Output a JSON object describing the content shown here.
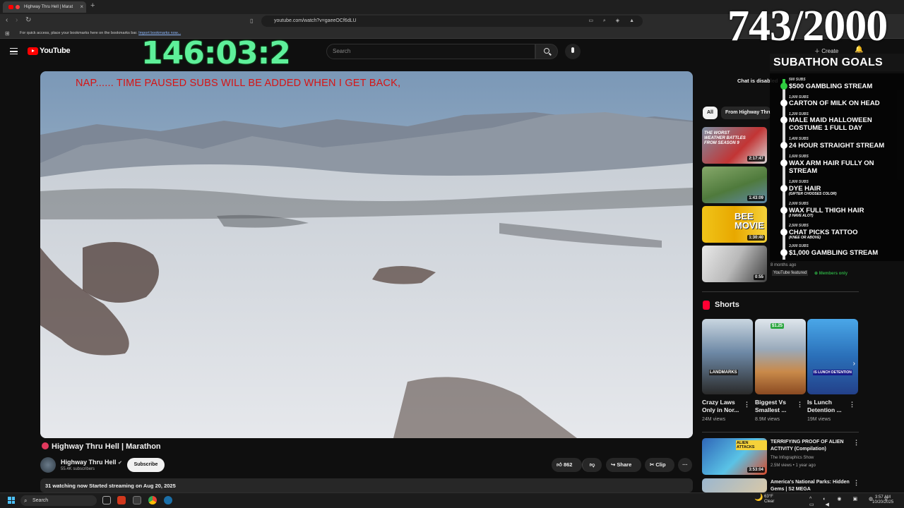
{
  "browser": {
    "tab_title": "Highway Thru Hell | Marat",
    "tab_close": "×",
    "new_tab": "+",
    "url": "youtube.com/watch?v=gaeeOCf6dLU",
    "bookmarks_hint": "For quick access, place your bookmarks here on the bookmarks bar.",
    "bookmarks_link": "Import bookmarks now..."
  },
  "header": {
    "logo_text": "YouTube",
    "search_placeholder": "Search",
    "create_label": "Create"
  },
  "stream_overlay": {
    "timer": "146:03:2",
    "sub_count": "743/2000",
    "video_banner": "NAP......  TIME PAUSED SUBS WILL BE ADDED WHEN I GET BACK,",
    "goals_title": "SUBATHON GOALS",
    "goals": [
      {
        "subs": "500 SUBS",
        "title": "$500 GAMBLING STREAM",
        "note": ""
      },
      {
        "subs": "1,000 SUBS",
        "title": "CARTON OF MILK ON HEAD",
        "note": ""
      },
      {
        "subs": "1,200 SUBS",
        "title": "MALE MAID HALLOWEEN COSTUME 1 FULL DAY",
        "note": ""
      },
      {
        "subs": "1,400 SUBS",
        "title": "24 HOUR STRAIGHT STREAM",
        "note": ""
      },
      {
        "subs": "1,600 SUBS",
        "title": "WAX ARM HAIR FULLY ON STREAM",
        "note": ""
      },
      {
        "subs": "1,800 SUBS",
        "title": "DYE HAIR",
        "note": "(GIFTER CHOOSES COLOR)"
      },
      {
        "subs": "2,000 SUBS",
        "title": "WAX FULL THIGH HAIR",
        "note": "(I HAVE ALOT)"
      },
      {
        "subs": "2,500 SUBS",
        "title": "CHAT PICKS TATTOO",
        "note": "(KNEE OR ABOVE)"
      },
      {
        "subs": "3,000 SUBS",
        "title": "$1,000 GAMBLING STREAM",
        "note": ""
      }
    ]
  },
  "video": {
    "title": "Highway Thru Hell | Marathon",
    "channel": "Highway Thru Hell",
    "subscribers": "55.4K subscribers",
    "subscribe_label": "Subscribe",
    "likes": "862",
    "share_label": "Share",
    "clip_label": "Clip",
    "more": "···",
    "description_line": "31 watching now  Started streaming on Aug 20, 2025"
  },
  "sidebar": {
    "chat_disabled": "Chat is disabled",
    "chips": [
      "All",
      "From Highway Thru Hell"
    ],
    "thumbs": [
      {
        "duration": "2:17:47",
        "text": "THE WORST WEATHER BATTLES FROM SEASON 9"
      },
      {
        "duration": "1:43:09",
        "text": ""
      },
      {
        "duration": "1:30:40",
        "text": "BEE MOVIE"
      },
      {
        "duration": "0:55",
        "text": ""
      }
    ],
    "last_age": "8 months ago",
    "featured": "YouTube featured",
    "members_only": "Members only",
    "shorts_label": "Shorts",
    "shorts": [
      {
        "title": "Crazy Laws Only in Nor...",
        "views": "24M views",
        "badge": "LANDMARKS"
      },
      {
        "title": "Biggest Vs Smallest ...",
        "views": "8.9M views",
        "badge": "$1.25"
      },
      {
        "title": "Is Lunch Detention ...",
        "views": "19M views",
        "badge": "IS LUNCH DETENTION"
      }
    ],
    "recs": [
      {
        "title": "TERRIFYING PROOF OF ALIEN ACTIVITY (Compilation)",
        "channel": "The Infographics Show",
        "meta": "2.5M views • 1 year ago",
        "duration": "3:53:04",
        "badge": "ALIEN ATTACKS"
      },
      {
        "title": "America's National Parks: Hidden Gems | S2 MEGA",
        "channel": "",
        "meta": "",
        "duration": "",
        "badge": ""
      }
    ]
  },
  "taskbar": {
    "search_label": "Search",
    "weather_temp": "63°F",
    "weather_cond": "Clear",
    "time": "3:57 AM",
    "date": "10/20/2025"
  }
}
